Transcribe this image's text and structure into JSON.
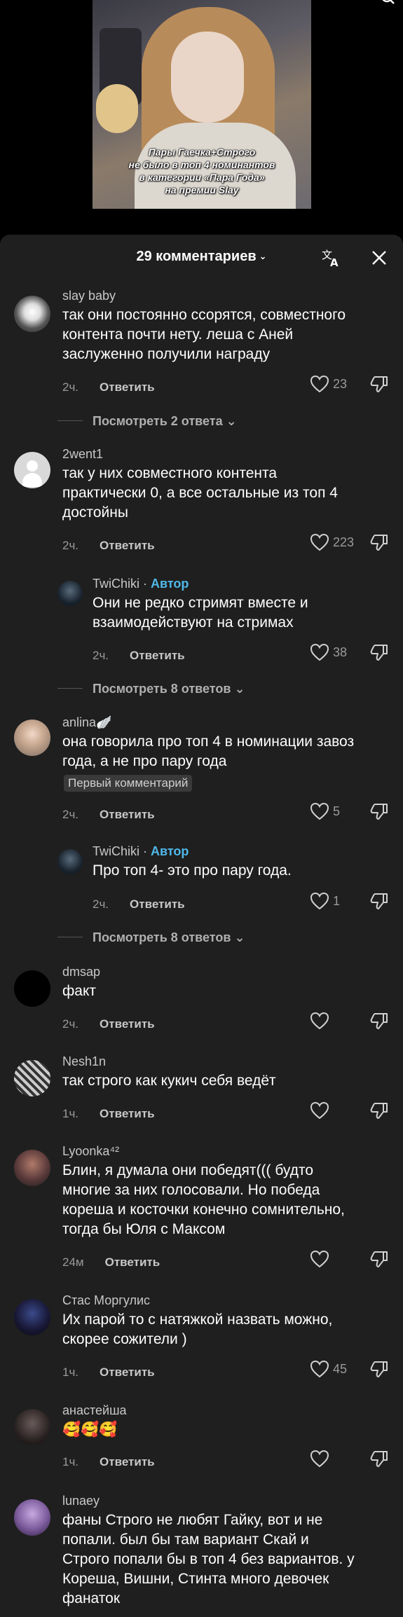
{
  "video": {
    "caption_lines": [
      "Пары Гаечка+Строго",
      "не было в топ 4 номинантов",
      "в категории «Пара Года»",
      "на премии Slay"
    ]
  },
  "header": {
    "title": "29 комментариев",
    "chevron": "⌄"
  },
  "comments": [
    {
      "user": "slay baby",
      "text": [
        "так они постоянно ссорятся, совместного",
        "контента почти нету. леша с Аней",
        "заслуженно получили награду"
      ],
      "time": "2ч.",
      "reply": "Ответить",
      "likes": "23",
      "view_more": "Посмотреть 2 ответа"
    },
    {
      "user": "2went1",
      "text": [
        "так у них совместного контента",
        "практически 0, а все остальные из топ 4",
        "достойны"
      ],
      "time": "2ч.",
      "reply": "Ответить",
      "likes": "223"
    },
    {
      "user": "TwiChiki",
      "author": "Автор",
      "text": [
        "Они не редко стримят вместе и",
        "взаимодействуют на стримах"
      ],
      "time": "2ч.",
      "reply": "Ответить",
      "likes": "38",
      "view_more": "Посмотреть 8 ответов"
    },
    {
      "user": "anlina🪽",
      "text": [
        "она говорила про топ 4 в номинации завоз",
        "года, а не про пару года"
      ],
      "badge": "Первый комментарий",
      "time": "2ч.",
      "reply": "Ответить",
      "likes": "5"
    },
    {
      "user": "TwiChiki",
      "author": "Автор",
      "text": [
        "Про топ 4- это про пару года."
      ],
      "time": "2ч.",
      "reply": "Ответить",
      "likes": "1",
      "view_more": "Посмотреть 8 ответов"
    },
    {
      "user": "dmsap",
      "text": [
        "факт"
      ],
      "time": "2ч.",
      "reply": "Ответить",
      "likes": ""
    },
    {
      "user": "Nesh1n",
      "text": [
        "так строго как кукич себя ведёт"
      ],
      "time": "1ч.",
      "reply": "Ответить",
      "likes": ""
    },
    {
      "user": "Lyoonka⁴²",
      "text": [
        "Блин, я думала они победят((( будто",
        "многие за них голосовали. Но победа",
        "кореша и косточки конечно сомнительно,",
        "тогда бы Юля с Максом"
      ],
      "time": "24м",
      "reply": "Ответить",
      "likes": ""
    },
    {
      "user": "Стас Моргулис",
      "text": [
        "Их парой то с натяжкой назвать можно,",
        "скорее сожители )"
      ],
      "time": "1ч.",
      "reply": "Ответить",
      "likes": "45"
    },
    {
      "user": "анастейша",
      "text": [
        "🥰🥰🥰"
      ],
      "time": "1ч.",
      "reply": "Ответить",
      "likes": ""
    },
    {
      "user": "lunaey",
      "text": [
        "фаны Строго не любят Гайку, вот и не",
        "попали. был бы там вариант Скай и",
        "Строго попали бы в топ 4 без вариантов. у",
        "Кореша, Вишни, Стинта много девочек",
        "фанаток"
      ]
    }
  ]
}
